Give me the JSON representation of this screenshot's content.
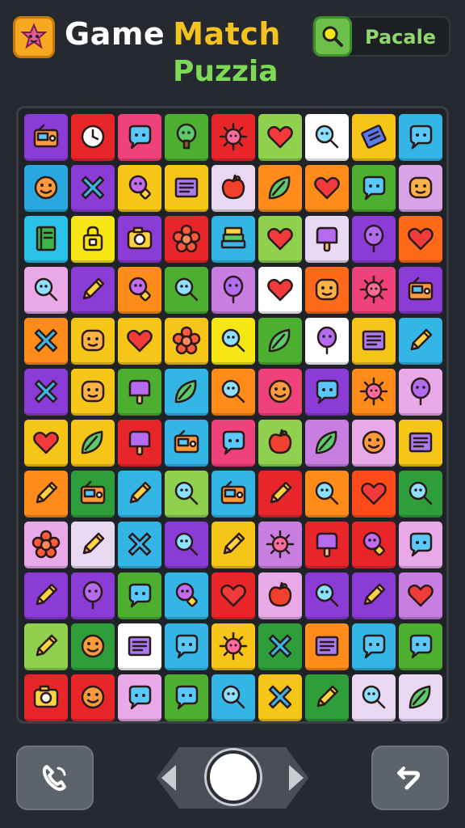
{
  "header": {
    "title_word1": "Game",
    "title_word2": "Match",
    "title_line2": "Puzzia",
    "app_icon": "puzzle-star-icon",
    "profile": {
      "icon": "magnifier-icon",
      "label": "Pacale"
    }
  },
  "colors": {
    "background": "#262a30",
    "title_white": "#ffffff",
    "title_yellow": "#f5c320",
    "title_green": "#7ed957"
  },
  "board": {
    "rows": 12,
    "cols": 9,
    "tiles": [
      [
        {
          "c": "#8b3bd6",
          "i": "radio"
        },
        {
          "c": "#e8262a",
          "i": "clock"
        },
        {
          "c": "#f0427a",
          "i": "chat"
        },
        {
          "c": "#4caf30",
          "i": "tree"
        },
        {
          "c": "#e8262a",
          "i": "sun"
        },
        {
          "c": "#8fd14f",
          "i": "heart"
        },
        {
          "c": "#ffffff",
          "i": "magnifier"
        },
        {
          "c": "#f5c518",
          "i": "ticket"
        },
        {
          "c": "#33b5e5",
          "i": "chat"
        }
      ],
      [
        {
          "c": "#29a8e0",
          "i": "smile"
        },
        {
          "c": "#8b3bd6",
          "i": "cross"
        },
        {
          "c": "#f5c518",
          "i": "bulb"
        },
        {
          "c": "#f5c518",
          "i": "note"
        },
        {
          "c": "#e9d8f2",
          "i": "apple"
        },
        {
          "c": "#ff8c1a",
          "i": "leaf"
        },
        {
          "c": "#ff8c1a",
          "i": "heart"
        },
        {
          "c": "#4caf30",
          "i": "chat"
        },
        {
          "c": "#d9a3e8",
          "i": "face"
        }
      ],
      [
        {
          "c": "#29c3e8",
          "i": "book"
        },
        {
          "c": "#f5e614",
          "i": "lock"
        },
        {
          "c": "#8b3bd6",
          "i": "camera"
        },
        {
          "c": "#e8262a",
          "i": "flower"
        },
        {
          "c": "#33b5e5",
          "i": "books"
        },
        {
          "c": "#8fd14f",
          "i": "heart"
        },
        {
          "c": "#e9d8f2",
          "i": "popsicle"
        },
        {
          "c": "#8b3bd6",
          "i": "balloon"
        },
        {
          "c": "#ff6a1a",
          "i": "heart"
        }
      ],
      [
        {
          "c": "#e9a8e8",
          "i": "magnifier"
        },
        {
          "c": "#8b3bd6",
          "i": "pencil"
        },
        {
          "c": "#ff8c1a",
          "i": "bulb"
        },
        {
          "c": "#4caf30",
          "i": "magnifier"
        },
        {
          "c": "#c77ee0",
          "i": "balloon"
        },
        {
          "c": "#ffffff",
          "i": "heart"
        },
        {
          "c": "#ff6a1a",
          "i": "face"
        },
        {
          "c": "#f0427a",
          "i": "sun"
        },
        {
          "c": "#8b3bd6",
          "i": "radio"
        }
      ],
      [
        {
          "c": "#ff8c1a",
          "i": "cross"
        },
        {
          "c": "#f5c518",
          "i": "face"
        },
        {
          "c": "#f5c518",
          "i": "heart"
        },
        {
          "c": "#f5c518",
          "i": "flower"
        },
        {
          "c": "#f5e614",
          "i": "magnifier"
        },
        {
          "c": "#4caf30",
          "i": "leaf"
        },
        {
          "c": "#ffffff",
          "i": "balloon"
        },
        {
          "c": "#f5c518",
          "i": "note"
        },
        {
          "c": "#33b5e5",
          "i": "pencil"
        }
      ],
      [
        {
          "c": "#8b3bd6",
          "i": "cross"
        },
        {
          "c": "#f5c518",
          "i": "face"
        },
        {
          "c": "#4caf30",
          "i": "popsicle"
        },
        {
          "c": "#33b5e5",
          "i": "leaf"
        },
        {
          "c": "#ff8c1a",
          "i": "magnifier"
        },
        {
          "c": "#f0427a",
          "i": "smile"
        },
        {
          "c": "#8b3bd6",
          "i": "chat"
        },
        {
          "c": "#ff8c1a",
          "i": "sun"
        },
        {
          "c": "#e9a8e8",
          "i": "balloon"
        }
      ],
      [
        {
          "c": "#f5c518",
          "i": "heart"
        },
        {
          "c": "#f5c518",
          "i": "leaf"
        },
        {
          "c": "#e8262a",
          "i": "popsicle"
        },
        {
          "c": "#33b5e5",
          "i": "radio"
        },
        {
          "c": "#f0427a",
          "i": "chat"
        },
        {
          "c": "#8fd14f",
          "i": "apple"
        },
        {
          "c": "#c77ee0",
          "i": "leaf"
        },
        {
          "c": "#e9a8e8",
          "i": "smile"
        },
        {
          "c": "#f5c518",
          "i": "note"
        }
      ],
      [
        {
          "c": "#ff8c1a",
          "i": "pencil"
        },
        {
          "c": "#2e9e3a",
          "i": "radio"
        },
        {
          "c": "#33b5e5",
          "i": "pencil"
        },
        {
          "c": "#8fd14f",
          "i": "magnifier"
        },
        {
          "c": "#33b5e5",
          "i": "radio"
        },
        {
          "c": "#e8262a",
          "i": "pencil"
        },
        {
          "c": "#ff8c1a",
          "i": "magnifier"
        },
        {
          "c": "#ff4a1a",
          "i": "heart"
        },
        {
          "c": "#2e9e3a",
          "i": "magnifier"
        }
      ],
      [
        {
          "c": "#e9a8e8",
          "i": "flower"
        },
        {
          "c": "#e9d8f2",
          "i": "pencil"
        },
        {
          "c": "#33b5e5",
          "i": "cross"
        },
        {
          "c": "#8b3bd6",
          "i": "magnifier"
        },
        {
          "c": "#f5c518",
          "i": "pencil"
        },
        {
          "c": "#c77ee0",
          "i": "sun"
        },
        {
          "c": "#e8262a",
          "i": "popsicle"
        },
        {
          "c": "#e8262a",
          "i": "bulb"
        },
        {
          "c": "#e9a8e8",
          "i": "chat"
        }
      ],
      [
        {
          "c": "#8b3bd6",
          "i": "pencil"
        },
        {
          "c": "#8b3bd6",
          "i": "balloon"
        },
        {
          "c": "#4caf30",
          "i": "chat"
        },
        {
          "c": "#33b5e5",
          "i": "bulb"
        },
        {
          "c": "#e8262a",
          "i": "heart"
        },
        {
          "c": "#e9a8e8",
          "i": "apple"
        },
        {
          "c": "#8b3bd6",
          "i": "magnifier"
        },
        {
          "c": "#8b3bd6",
          "i": "pencil"
        },
        {
          "c": "#c77ee0",
          "i": "heart"
        }
      ],
      [
        {
          "c": "#8fd14f",
          "i": "pencil"
        },
        {
          "c": "#2e9e3a",
          "i": "smile"
        },
        {
          "c": "#ffffff",
          "i": "note"
        },
        {
          "c": "#33b5e5",
          "i": "chat"
        },
        {
          "c": "#f5c518",
          "i": "sun"
        },
        {
          "c": "#2e9e3a",
          "i": "cross"
        },
        {
          "c": "#ff8c1a",
          "i": "note"
        },
        {
          "c": "#33b5e5",
          "i": "chat"
        },
        {
          "c": "#4caf30",
          "i": "chat"
        }
      ],
      [
        {
          "c": "#e8262a",
          "i": "camera"
        },
        {
          "c": "#e8262a",
          "i": "smile"
        },
        {
          "c": "#e9a8e8",
          "i": "chat"
        },
        {
          "c": "#4caf30",
          "i": "chat"
        },
        {
          "c": "#33b5e5",
          "i": "magnifier"
        },
        {
          "c": "#f5c518",
          "i": "cross"
        },
        {
          "c": "#2e9e3a",
          "i": "pencil"
        },
        {
          "c": "#e9d8f2",
          "i": "magnifier"
        },
        {
          "c": "#e9d8f2",
          "i": "leaf"
        }
      ]
    ]
  },
  "controls": {
    "left_icon": "phone-icon",
    "center_icon": "home-circle-icon",
    "right_icon": "swap-arrow-icon"
  }
}
